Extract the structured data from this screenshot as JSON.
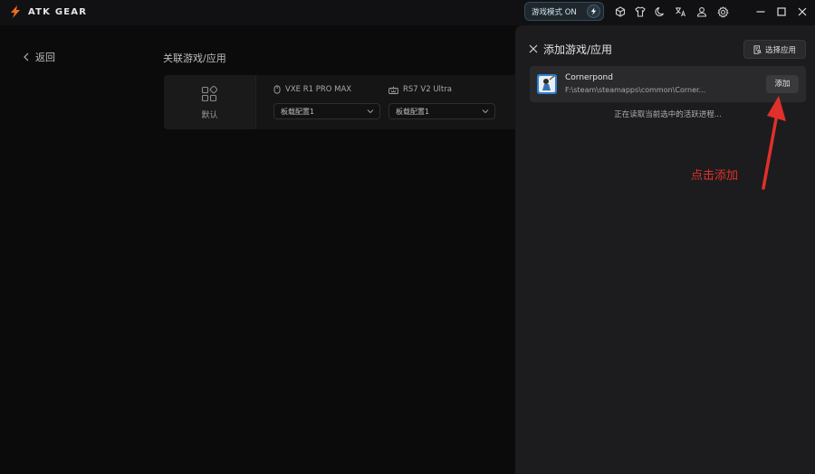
{
  "titlebar": {
    "brand": "ATK GEAR",
    "mode_label": "游戏模式 ON",
    "icons": [
      "cube-icon",
      "shirt-icon",
      "moon-icon",
      "translate-icon",
      "user-icon",
      "gear-icon"
    ],
    "window_controls": [
      "minimize-icon",
      "maximize-icon",
      "close-icon"
    ]
  },
  "page": {
    "back_label": "返回",
    "section_title": "关联游戏/应用",
    "default_label": "默认",
    "devices": [
      {
        "name": "VXE R1 PRO MAX",
        "icon": "mouse-icon",
        "profile": "板载配置1"
      },
      {
        "name": "RS7 V2 Ultra",
        "icon": "keyboard-icon",
        "profile": "板载配置1"
      }
    ]
  },
  "panel": {
    "title": "添加游戏/应用",
    "select_app_label": "选择应用",
    "app": {
      "name": "Cornerpond",
      "path": "F:\\steam\\steamapps\\common\\Corner..."
    },
    "add_label": "添加",
    "reading_status": "正在读取当前选中的活跃进程...",
    "annotation": "点击添加"
  },
  "colors": {
    "background": "#0b0b0c",
    "panel": "#1c1c1e",
    "accent_orange": "#f26b1d",
    "annotation_red": "#e0302b"
  }
}
